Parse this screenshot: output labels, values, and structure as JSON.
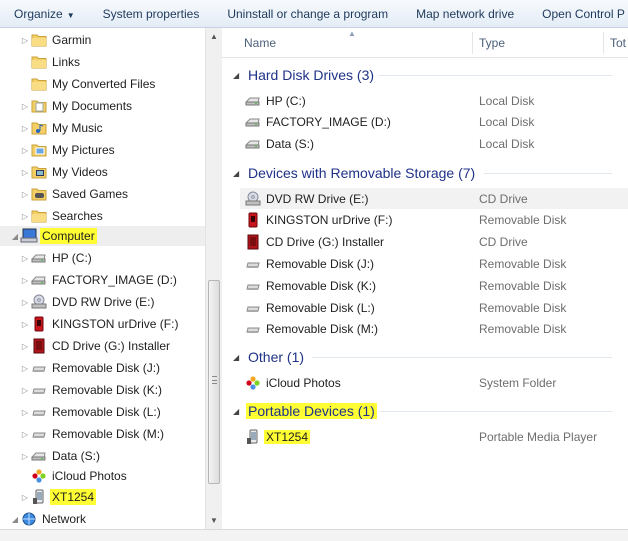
{
  "toolbar": {
    "organize": "Organize",
    "system_properties": "System properties",
    "uninstall": "Uninstall or change a program",
    "map_drive": "Map network drive",
    "control_panel": "Open Control P"
  },
  "nav": {
    "items": [
      {
        "label": "Garmin",
        "icon": "folder-icon"
      },
      {
        "label": "Links",
        "icon": "folder-icon"
      },
      {
        "label": "My Converted Files",
        "icon": "folder-icon"
      },
      {
        "label": "My Documents",
        "icon": "documents-icon"
      },
      {
        "label": "My Music",
        "icon": "music-icon"
      },
      {
        "label": "My Pictures",
        "icon": "pictures-icon"
      },
      {
        "label": "My Videos",
        "icon": "videos-icon"
      },
      {
        "label": "Saved Games",
        "icon": "games-icon"
      },
      {
        "label": "Searches",
        "icon": "folder-icon"
      },
      {
        "label": "Computer",
        "icon": "computer-icon"
      },
      {
        "label": "HP (C:)",
        "icon": "drive-icon"
      },
      {
        "label": "FACTORY_IMAGE (D:)",
        "icon": "drive-icon"
      },
      {
        "label": "DVD RW Drive (E:)",
        "icon": "dvd-drive-icon"
      },
      {
        "label": "KINGSTON urDrive (F:)",
        "icon": "usb-drive-icon"
      },
      {
        "label": "CD Drive (G:) Installer",
        "icon": "cd-installer-icon"
      },
      {
        "label": "Removable Disk (J:)",
        "icon": "removable-disk-icon"
      },
      {
        "label": "Removable Disk (K:)",
        "icon": "removable-disk-icon"
      },
      {
        "label": "Removable Disk (L:)",
        "icon": "removable-disk-icon"
      },
      {
        "label": "Removable Disk (M:)",
        "icon": "removable-disk-icon"
      },
      {
        "label": "Data (S:)",
        "icon": "drive-icon"
      },
      {
        "label": "iCloud Photos",
        "icon": "icloud-photos-icon"
      },
      {
        "label": "XT1254",
        "icon": "phone-icon"
      },
      {
        "label": "Network",
        "icon": "network-icon"
      }
    ]
  },
  "columns": {
    "name": "Name",
    "type": "Type",
    "total": "Tot"
  },
  "groups": [
    {
      "title": "Hard Disk Drives (3)",
      "rows": [
        {
          "name": "HP (C:)",
          "type": "Local Disk",
          "icon": "drive-icon"
        },
        {
          "name": "FACTORY_IMAGE (D:)",
          "type": "Local Disk",
          "icon": "drive-icon"
        },
        {
          "name": "Data (S:)",
          "type": "Local Disk",
          "icon": "drive-icon"
        }
      ]
    },
    {
      "title": "Devices with Removable Storage (7)",
      "rows": [
        {
          "name": "DVD RW Drive (E:)",
          "type": "CD Drive",
          "icon": "dvd-drive-icon"
        },
        {
          "name": "KINGSTON urDrive (F:)",
          "type": "Removable Disk",
          "icon": "usb-drive-icon"
        },
        {
          "name": "CD Drive (G:) Installer",
          "type": "CD Drive",
          "icon": "cd-installer-icon"
        },
        {
          "name": "Removable Disk (J:)",
          "type": "Removable Disk",
          "icon": "removable-disk-icon"
        },
        {
          "name": "Removable Disk (K:)",
          "type": "Removable Disk",
          "icon": "removable-disk-icon"
        },
        {
          "name": "Removable Disk (L:)",
          "type": "Removable Disk",
          "icon": "removable-disk-icon"
        },
        {
          "name": "Removable Disk (M:)",
          "type": "Removable Disk",
          "icon": "removable-disk-icon"
        }
      ]
    },
    {
      "title": "Other (1)",
      "rows": [
        {
          "name": "iCloud Photos",
          "type": "System Folder",
          "icon": "icloud-photos-icon"
        }
      ]
    },
    {
      "title": "Portable Devices (1)",
      "rows": [
        {
          "name": "XT1254",
          "type": "Portable Media Player",
          "icon": "phone-icon"
        }
      ]
    }
  ],
  "colors": {
    "highlight": "#ffff33",
    "group_title": "#1e3287"
  }
}
